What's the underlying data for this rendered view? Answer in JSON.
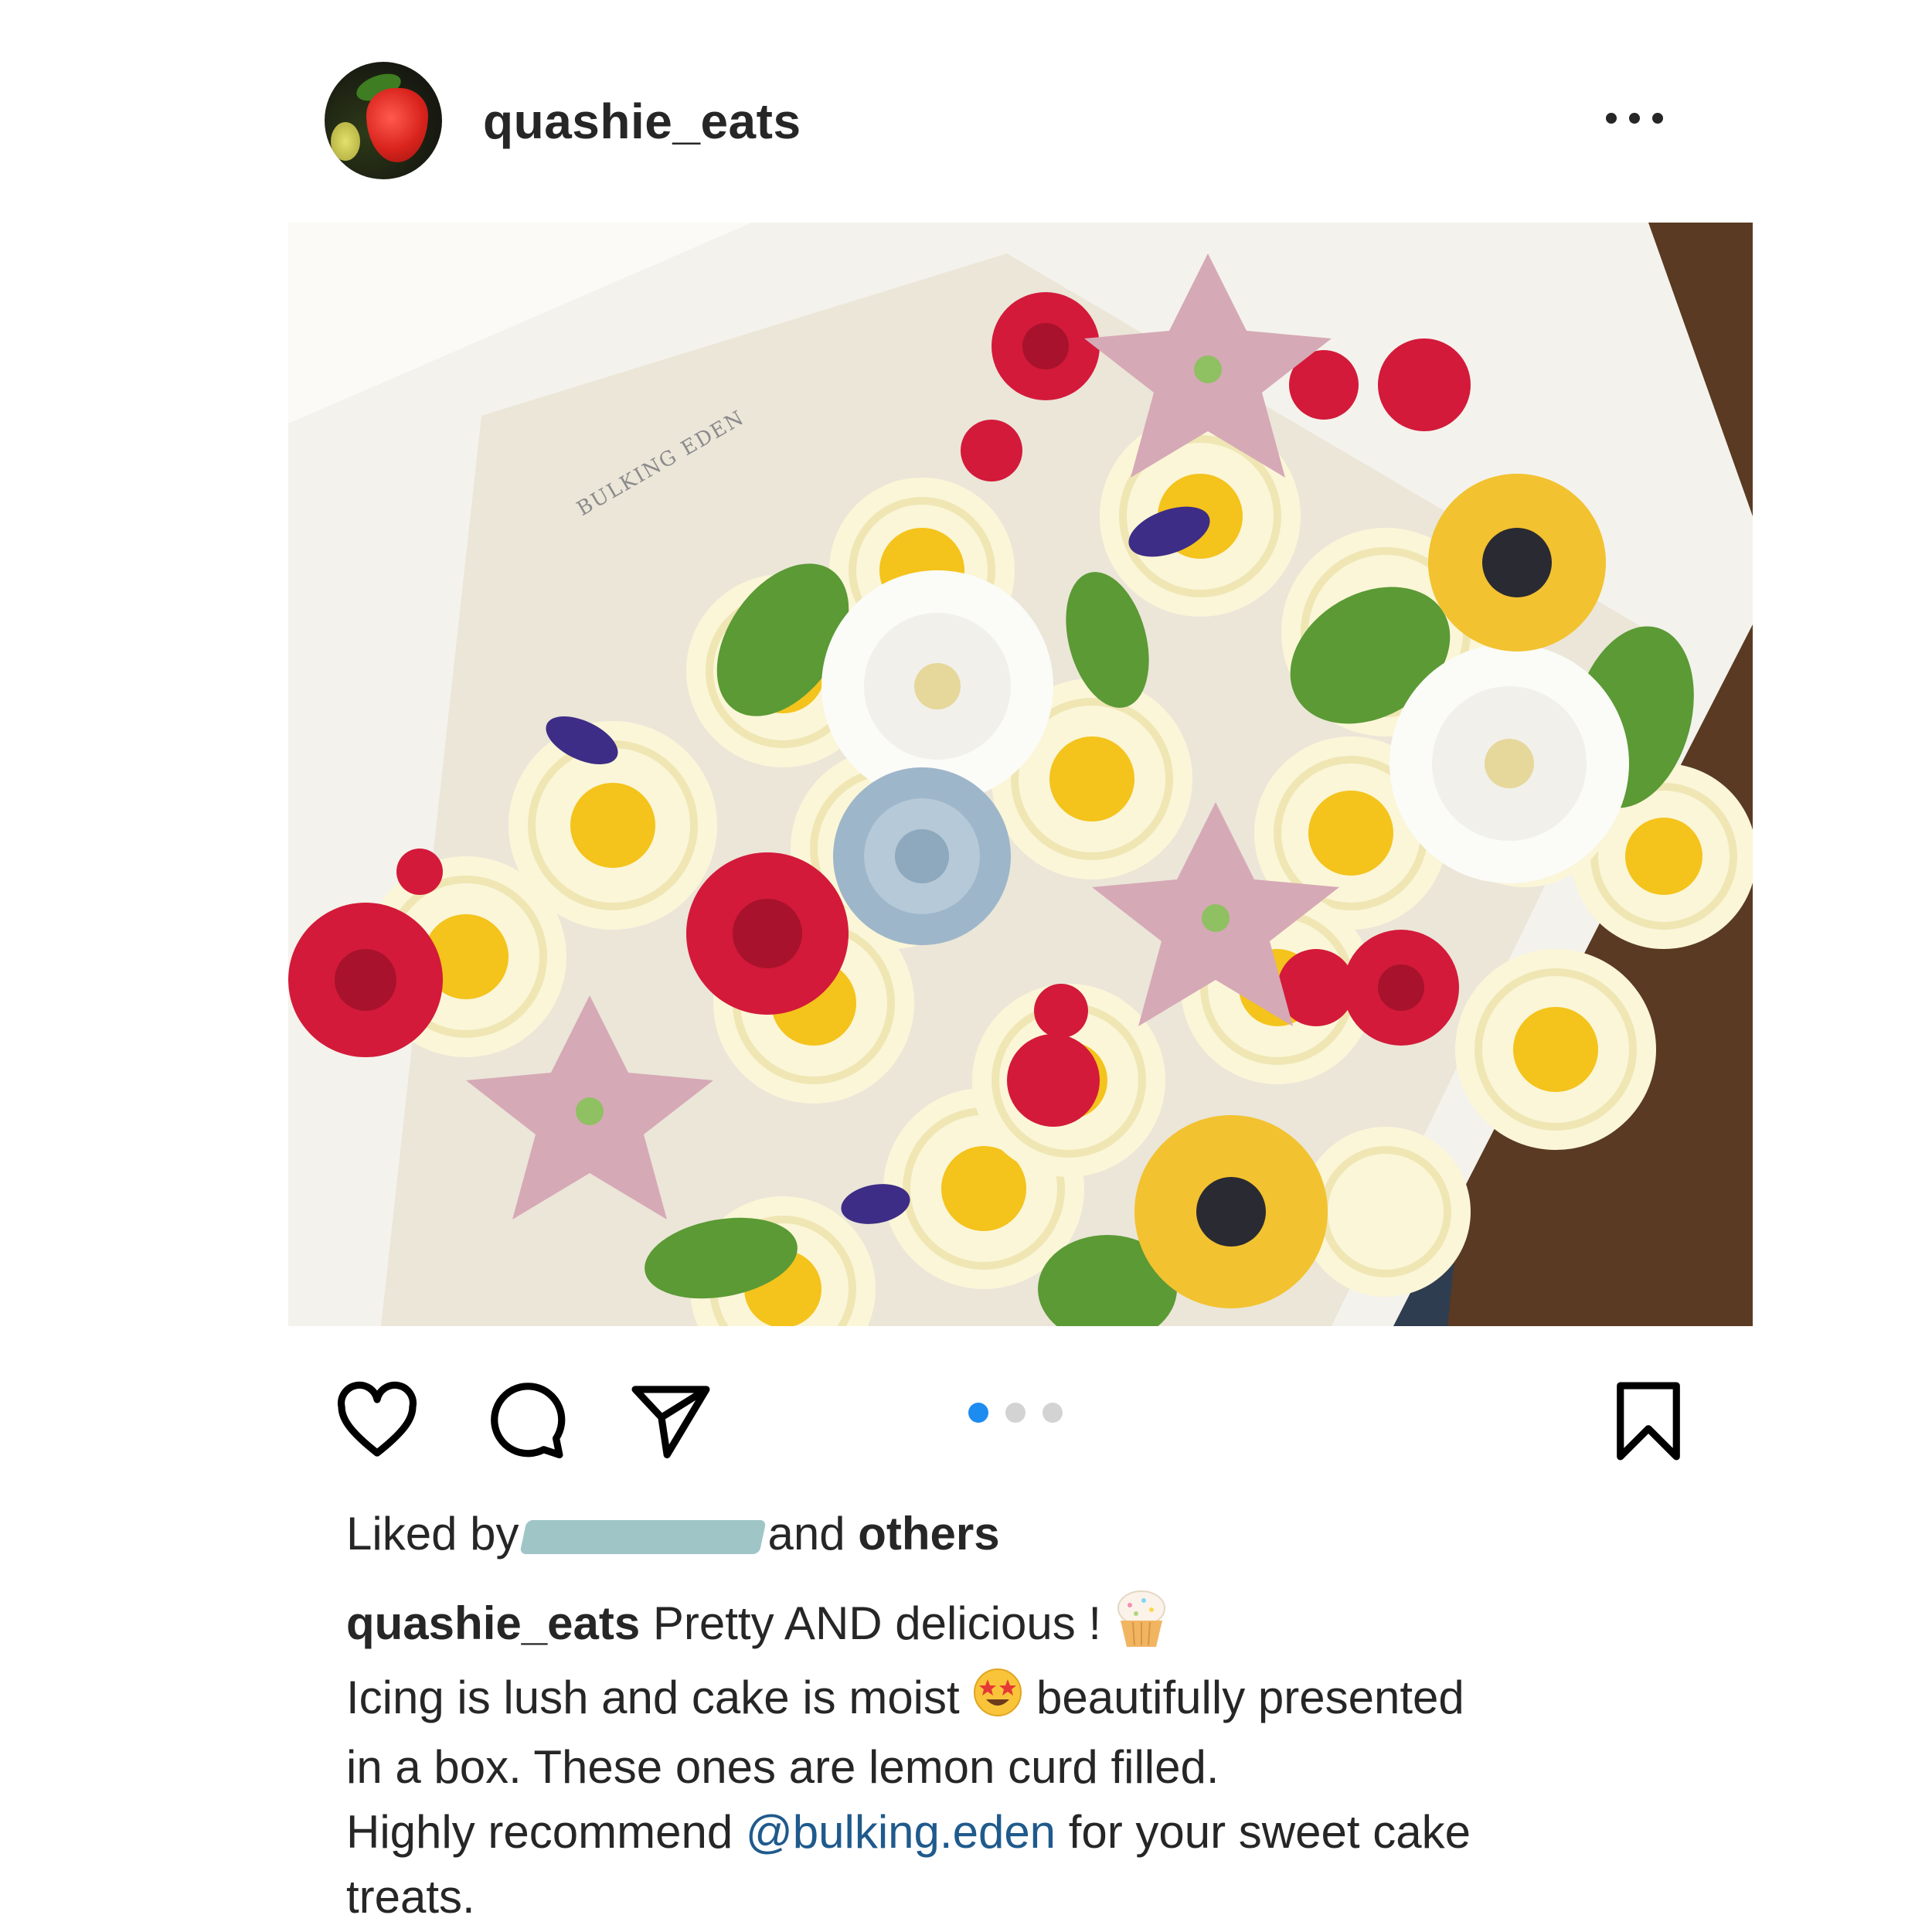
{
  "post": {
    "username": "quashie_eats",
    "avatar_icon": "strawberry-avatar"
  },
  "photo": {
    "box_brand": "BULKING EDEN"
  },
  "actions": {
    "like_icon": "heart-icon",
    "comment_icon": "comment-icon",
    "share_icon": "send-icon",
    "save_icon": "bookmark-icon",
    "carousel_count": 3,
    "carousel_active": 1,
    "active_dot_color": "#1d8cf0"
  },
  "likes": {
    "prefix": "Liked by",
    "suffix": "and",
    "others": "others"
  },
  "caption": {
    "username": "quashie_eats",
    "line1": " Pretty AND delicious ! ",
    "line2a": "Icing is lush and cake is moist ",
    "line2b": " beautifully presented",
    "line3": "in a box. These ones are lemon curd filled.",
    "line4a": "Highly recommend ",
    "mention": "@bulking.eden",
    "line4b": " for your sweet cake",
    "line5": "treats."
  }
}
